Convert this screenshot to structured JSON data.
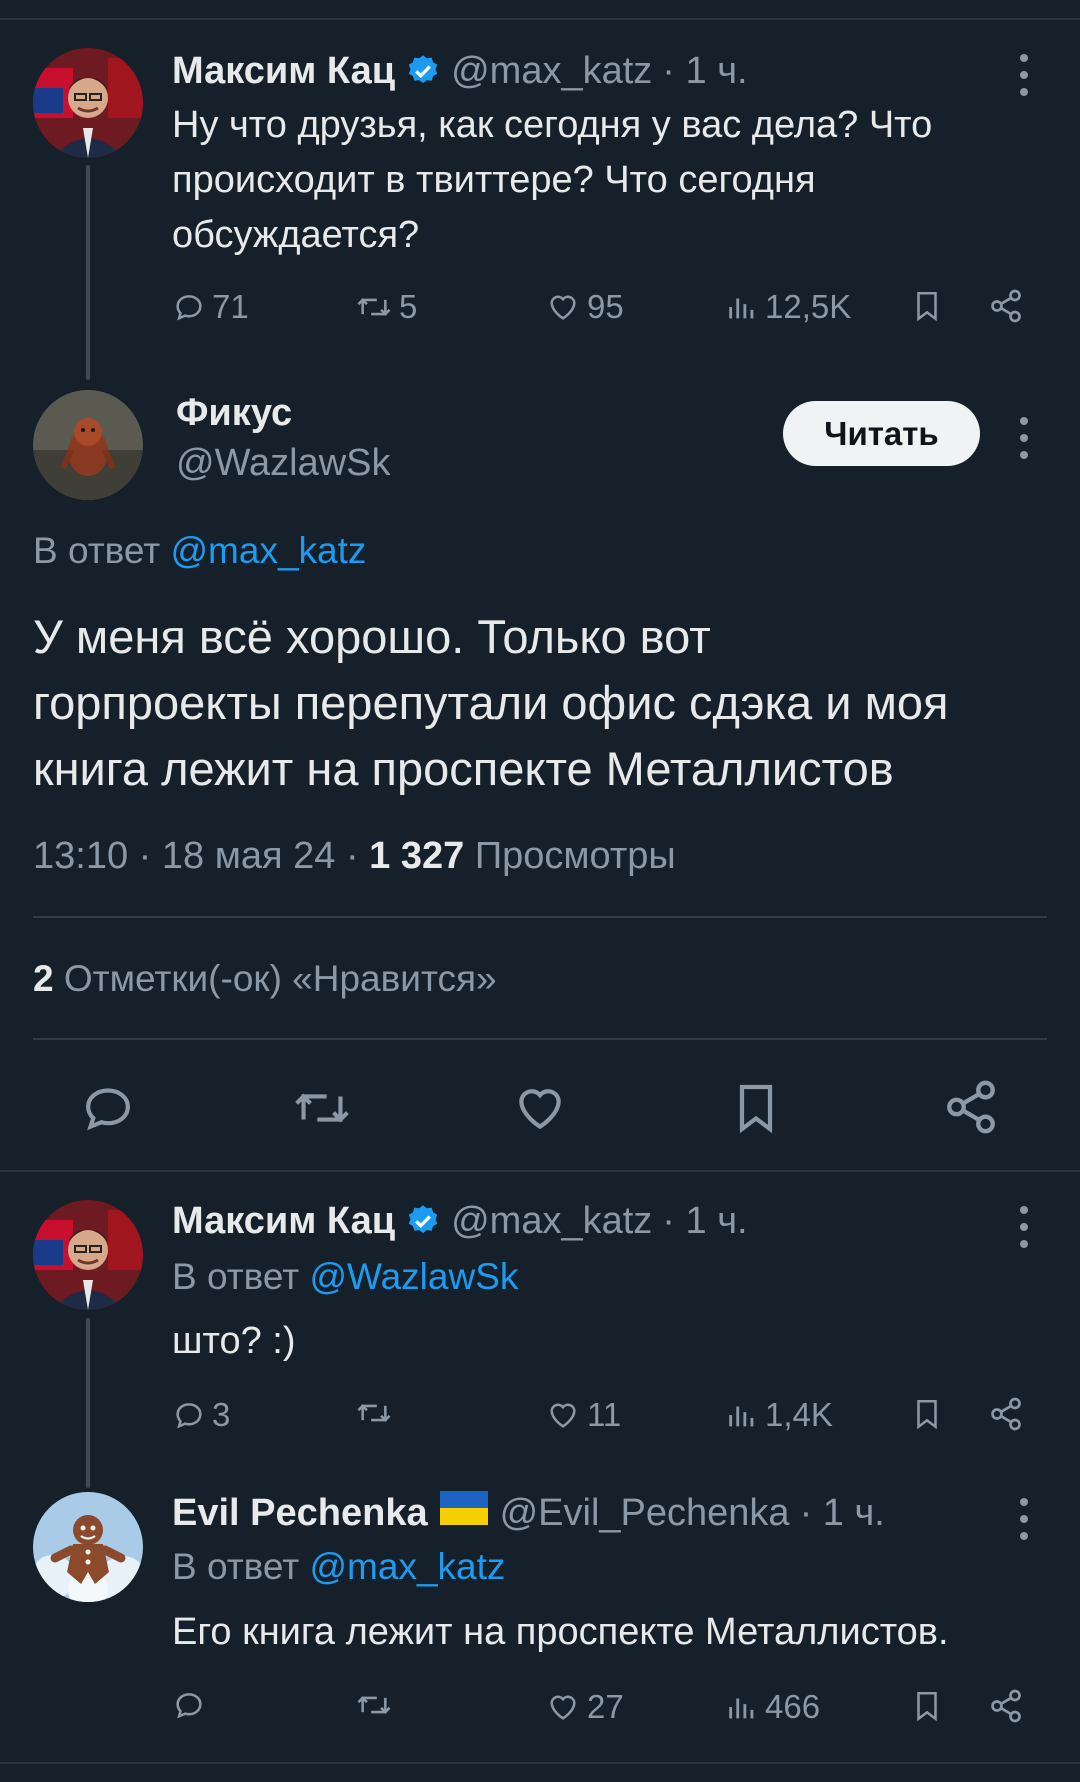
{
  "tweet1": {
    "name": "Максим Кац",
    "handle": "@max_katz",
    "time": "· 1 ч.",
    "text_lines": [
      "Ну что друзья, как сегодня у вас дела? Что",
      "происходит в твиттере? Что сегодня",
      "обсуждается?"
    ],
    "replies": "71",
    "retweets": "5",
    "likes": "95",
    "views": "12,5K"
  },
  "focus_tweet": {
    "name": "Фикус",
    "handle": "@WazlawSk",
    "follow_label": "Читать",
    "reply_prefix": "В ответ",
    "reply_to": "@max_katz",
    "text_lines": [
      "У меня всё хорошо. Только вот",
      "горпроекты перепутали офис сдэка и моя",
      "книга лежит на проспекте Металлистов"
    ],
    "time": "13:10",
    "date": "18 мая 24",
    "views_count": "1 327",
    "views_label": "Просмотры",
    "likes_count": "2",
    "likes_label": "Отметки(-ок) «Нравится»"
  },
  "tweet2": {
    "name": "Максим Кац",
    "handle": "@max_katz",
    "time": "· 1 ч.",
    "reply_prefix": "В ответ",
    "reply_to": "@WazlawSk",
    "text": "што? :)",
    "replies": "3",
    "retweets": "",
    "likes": "11",
    "views": "1,4K"
  },
  "tweet3": {
    "name": "Evil Pechenka",
    "flag": "🇺🇦",
    "handle": "@Evil_Pechenka",
    "time": "· 1 ч.",
    "reply_prefix": "В ответ",
    "reply_to": "@max_katz",
    "text": "Его книга лежит на проспекте Металлистов.",
    "replies": "",
    "retweets": "",
    "likes": "27",
    "views": "466"
  },
  "colors": {
    "background": "#15202b",
    "accent": "#1d9bf0",
    "muted": "#8b98a5",
    "text": "#e7e9ea"
  },
  "icons": [
    "verified-badge-icon",
    "reply-icon",
    "retweet-icon",
    "like-icon",
    "views-icon",
    "bookmark-icon",
    "share-icon",
    "more-icon"
  ]
}
